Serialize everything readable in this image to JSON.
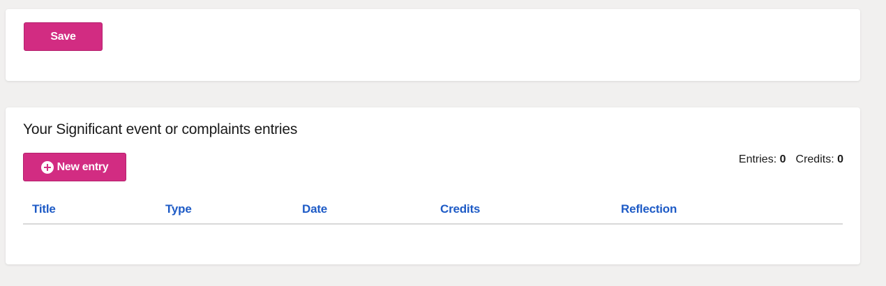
{
  "form_actions": {
    "save_label": "Save"
  },
  "entries_section": {
    "title": "Your Significant event or complaints entries",
    "new_entry_label": "New entry",
    "new_entry_icon": "plus-circle-icon",
    "entries_label": "Entries:",
    "entries_count": "0",
    "credits_label": "Credits:",
    "credits_count": "0",
    "table": {
      "columns": [
        "Title",
        "Type",
        "Date",
        "Credits",
        "Reflection"
      ],
      "rows": []
    }
  },
  "colors": {
    "primary_button": "#d22c82",
    "link_blue": "#1e5bc6",
    "page_background": "#f1f0ef"
  }
}
